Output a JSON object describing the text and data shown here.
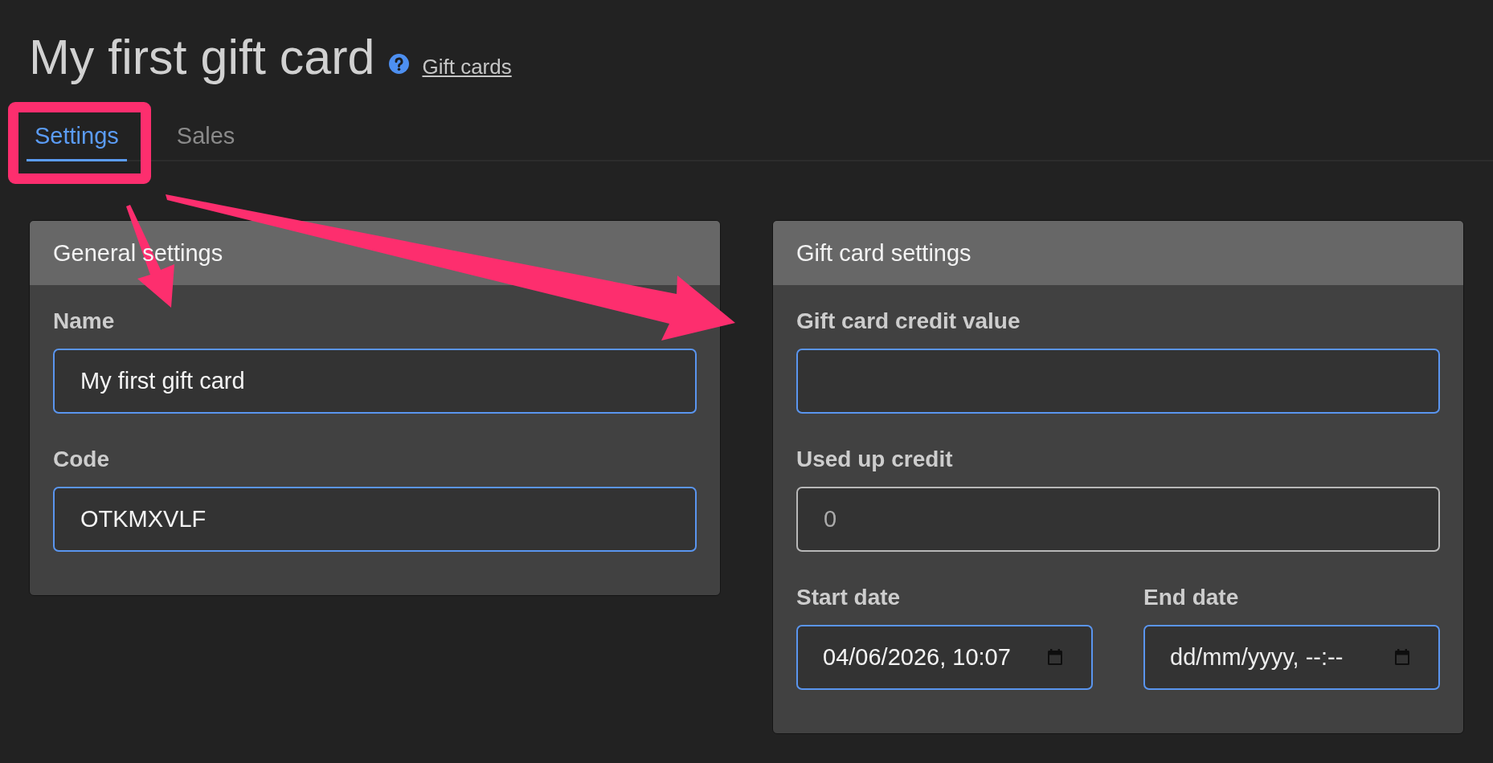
{
  "page": {
    "title": "My first gift card",
    "help_link": "Gift cards"
  },
  "tabs": [
    {
      "label": "Settings",
      "selected": true
    },
    {
      "label": "Sales",
      "selected": false
    }
  ],
  "panels": [
    {
      "title": "General settings",
      "fields": [
        {
          "kind": "text",
          "label": "Name",
          "value": "My first gift card",
          "disabled": false
        },
        {
          "kind": "text",
          "label": "Code",
          "value": "OTKMXVLF",
          "disabled": false
        }
      ]
    },
    {
      "title": "Gift card settings",
      "fields": [
        {
          "kind": "text",
          "label": "Gift card credit value",
          "disabled": false
        },
        {
          "kind": "text",
          "label": "Used up credit",
          "value": "0",
          "disabled": true
        },
        {
          "kind": "date",
          "label": "Start date",
          "value": "04/06/2026, 10:07",
          "disabled": false
        },
        {
          "kind": "date",
          "label": "End date",
          "placeholder": "dd/mm/yyyy, --:--",
          "disabled": false
        }
      ]
    }
  ]
}
